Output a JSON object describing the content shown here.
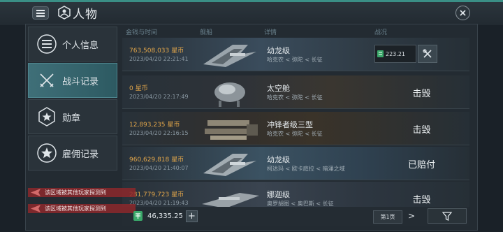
{
  "header": {
    "title": "人物"
  },
  "sidebar": {
    "items": [
      {
        "label": "个人信息",
        "icon": "list-icon"
      },
      {
        "label": "战斗记录",
        "icon": "crossed-swords-icon"
      },
      {
        "label": "勋章",
        "icon": "star-medal-icon"
      },
      {
        "label": "雇佣记录",
        "icon": "star-badge-icon"
      }
    ]
  },
  "table": {
    "headers": {
      "money_time": "金钱与时间",
      "ship": "舰船",
      "detail": "详情",
      "status": "战况"
    },
    "rows": [
      {
        "money": "763,508,033",
        "unit": "星币",
        "time": "2023/04/20 22:21:41",
        "ship": "幼龙级",
        "location": "哈克农 < 弥陀 < 长征",
        "status": "",
        "box_value": "223.21"
      },
      {
        "money": "0",
        "unit": "星币",
        "time": "2023/04/20 22:17:49",
        "ship": "太空舱",
        "location": "哈克农 < 弥陀 < 长征",
        "status": "击毁"
      },
      {
        "money": "12,893,235",
        "unit": "星币",
        "time": "2023/04/20 22:16:15",
        "ship": "冲锋者级三型",
        "location": "哈克农 < 弥陀 < 长征",
        "status": "击毁"
      },
      {
        "money": "960,629,818",
        "unit": "星币",
        "time": "2023/04/20 21:40:07",
        "ship": "幼龙级",
        "location": "柯达玛 < 欧卡庭拉 < 暗涌之域",
        "status": "已赔付"
      },
      {
        "money": "281,779,723",
        "unit": "星币",
        "time": "2023/04/20 21:19:43",
        "ship": "娜迦级",
        "location": "奥罗胡图 < 奥巴斯 < 长征",
        "status": "击毁"
      }
    ]
  },
  "notices": [
    "该区域被其他玩家探测到",
    "该区域被其他玩家探测到"
  ],
  "footer": {
    "balance": "46,335.25",
    "plus": "+",
    "page": "第1页",
    "next": ">"
  },
  "colors": {
    "accent": "#3a8f86",
    "money": "#e2a64a",
    "active_tab": "#3f6f78",
    "notice": "#8c282c"
  }
}
